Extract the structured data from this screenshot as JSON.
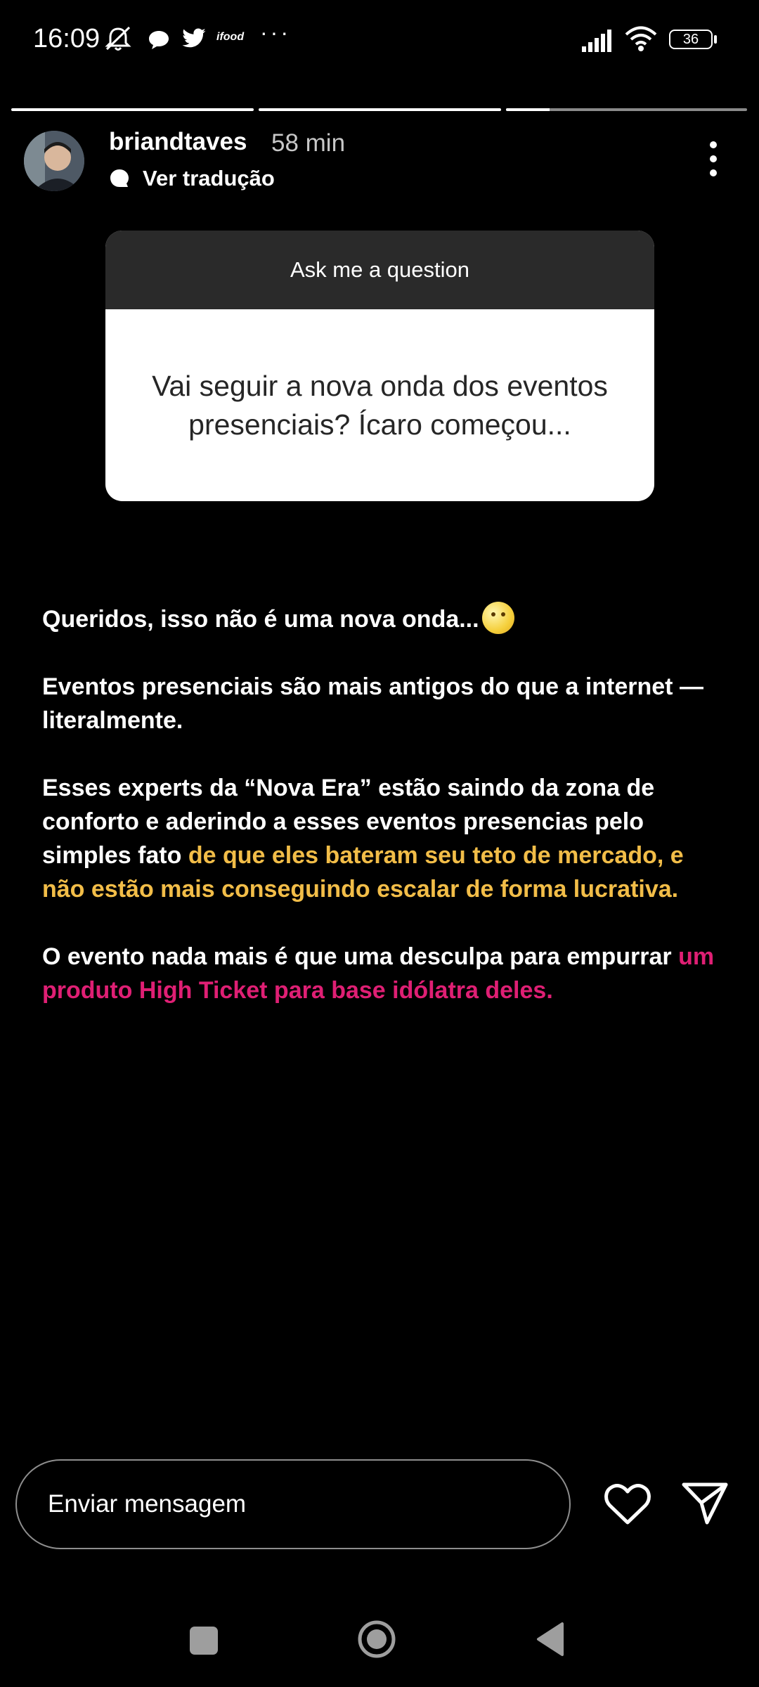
{
  "status_bar": {
    "time": "16:09",
    "app_icons": [
      "mute-icon",
      "chat-bubble-icon",
      "twitter-icon",
      "ifood-icon"
    ],
    "ifood_label": "ifood",
    "more": "···",
    "battery": "36"
  },
  "story": {
    "progress": [
      1.0,
      1.0,
      0.18
    ],
    "username": "briandtaves",
    "time_ago": "58 min",
    "translate_label": "Ver tradução"
  },
  "question_card": {
    "header": "Ask me a question",
    "question": "Vai seguir a nova onda dos eventos presenciais? Ícaro começou..."
  },
  "text": {
    "p1": "Queridos, isso não é uma nova onda...",
    "p2": "Eventos presenciais são mais antigos do que a internet — literalmente.",
    "p3_plain": "Esses experts da “Nova Era” estão saindo da zona de conforto e aderindo a esses eventos presencias pelo simples fato ",
    "p3_highlight": "de que eles bateram seu teto de mercado, e não estão mais conseguindo escalar de forma lucrativa.",
    "p4_plain": "O evento nada mais é que uma desculpa para empurrar ",
    "p4_highlight": "um produto High Ticket para base idólatra deles."
  },
  "colors": {
    "highlight_yellow": "#f2bd48",
    "highlight_pink": "#df1f74"
  },
  "reply": {
    "placeholder": "Enviar mensagem"
  }
}
